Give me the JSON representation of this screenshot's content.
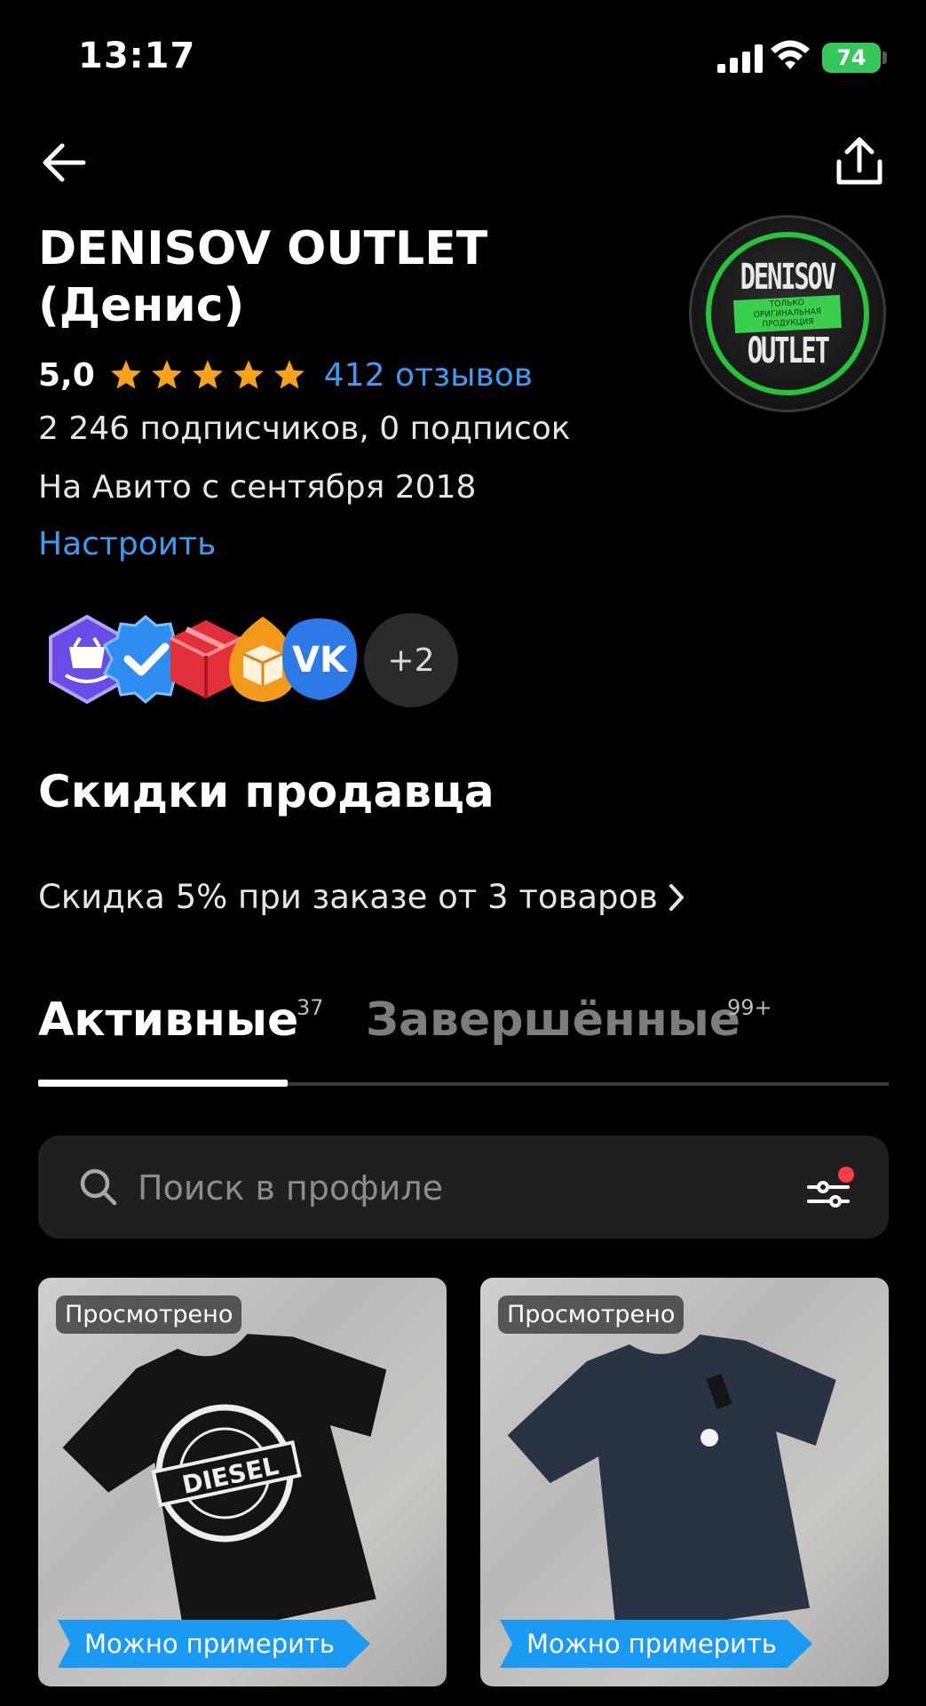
{
  "status_bar": {
    "time": "13:17",
    "battery": "74"
  },
  "header": {
    "title_line1": "DENISOV OUTLET",
    "title_line2": "(Денис)",
    "rating": "5,0",
    "stars": 5,
    "reviews": "412 отзывов",
    "subscribers": "2 246 подписчиков, 0 подписок",
    "since": "На Авито с сентября 2018",
    "configure": "Настроить",
    "avatar": {
      "line1": "DENISOV",
      "line2": "OUTLET",
      "tag": "ТОЛЬКО ОРИГИНАЛЬНАЯ ПРОДУКЦИЯ"
    }
  },
  "badges": {
    "icons": [
      "shop-badge-icon",
      "verified-badge-icon",
      "delivery-box-badge-icon",
      "parcel-badge-icon",
      "vk-badge-icon"
    ],
    "more": "+2"
  },
  "discounts": {
    "title": "Скидки продавца",
    "line": "Скидка 5% при заказе от 3 товаров"
  },
  "tabs": [
    {
      "label": "Активные",
      "count": "37",
      "active": true
    },
    {
      "label": "Завершённые",
      "count": "99+",
      "active": false
    }
  ],
  "search": {
    "placeholder": "Поиск в профиле"
  },
  "cards": [
    {
      "viewed": "Просмотрено",
      "tag": "Можно примерить",
      "shirt_color": "#141414",
      "print": "DIESEL"
    },
    {
      "viewed": "Просмотрено",
      "tag": "Можно примерить",
      "shirt_color": "#2a3344",
      "print": ""
    }
  ],
  "colors": {
    "accent_blue": "#3f9bf1",
    "star": "#f6a21a",
    "tag_blue": "#1a9af2",
    "avatar_green": "#27c33b"
  }
}
